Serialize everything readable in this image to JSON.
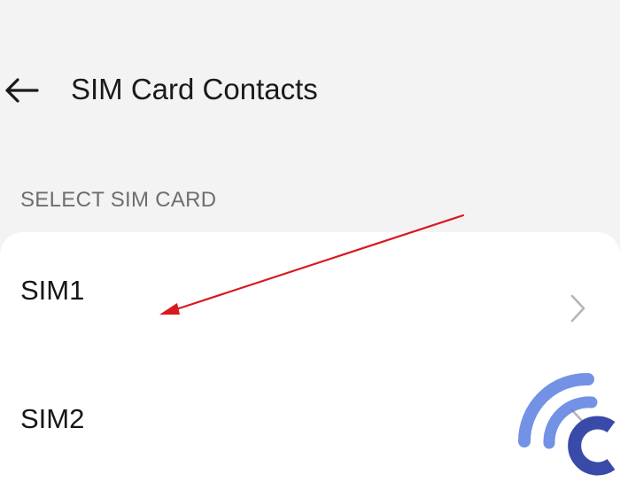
{
  "header": {
    "title": "SIM Card Contacts",
    "back_icon": "arrow-left-icon"
  },
  "section": {
    "label": "SELECT SIM CARD"
  },
  "sim_list": [
    {
      "label": "SIM1",
      "subtitle": "",
      "icon": "chevron-right-icon"
    },
    {
      "label": "SIM2",
      "icon": "chevron-right-icon"
    }
  ],
  "annotation": {
    "arrow_color": "#d71920"
  },
  "watermark": {
    "logo": "watermark-logo",
    "color": "#5b7fe0",
    "dark_color": "#3a4aa8"
  },
  "colors": {
    "background": "#f3f3f3",
    "card": "#ffffff",
    "text": "#161616",
    "section_text": "#6e6e6e",
    "chevron": "#b5b5b5"
  }
}
